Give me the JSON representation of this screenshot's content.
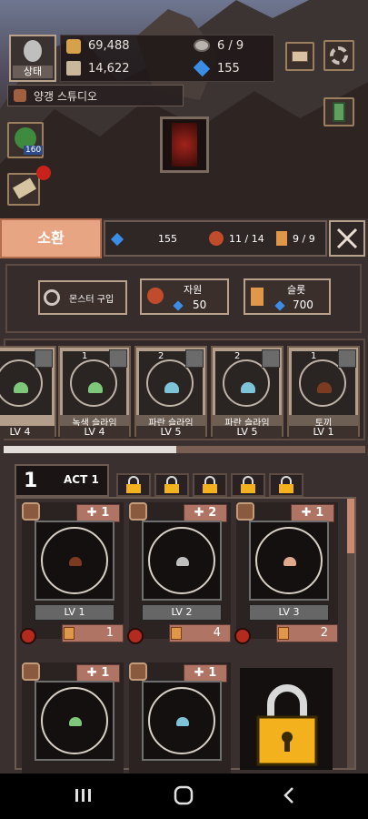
{
  "top": {
    "status_label": "상태",
    "gold": "69,488",
    "scroll": "14,622",
    "eye_count": "6 / 9",
    "gems": "155",
    "studio_name": "양갱 스튜디오",
    "clover_badge": "160"
  },
  "tabs": {
    "summon": "소환"
  },
  "resources": {
    "gems": "155",
    "meat": "11 / 14",
    "cards": "9 / 9"
  },
  "actions": {
    "buy_monster": "몬스터 구입",
    "resource_label": "자원",
    "resource_cost": "50",
    "slot_label": "슬롯",
    "slot_cost": "700"
  },
  "cards": [
    {
      "num": "",
      "name": "",
      "level": "LV 4"
    },
    {
      "num": "1",
      "name": "녹색 슬라임",
      "level": "LV 4"
    },
    {
      "num": "2",
      "name": "파란 슬라임",
      "level": "LV 5"
    },
    {
      "num": "2",
      "name": "파란 슬라임",
      "level": "LV 5"
    },
    {
      "num": "1",
      "name": "토끼",
      "level": "LV 1"
    }
  ],
  "act": {
    "number": "1",
    "label": "ACT 1"
  },
  "tiles": [
    {
      "plus": "1",
      "level": "LV 1",
      "count": "1"
    },
    {
      "plus": "2",
      "level": "LV 2",
      "count": "4"
    },
    {
      "plus": "1",
      "level": "LV 3",
      "count": "2"
    },
    {
      "plus": "1"
    },
    {
      "plus": "1"
    }
  ],
  "icons": [
    "person-icon",
    "gold-icon",
    "scroll-icon",
    "eye-icon",
    "gem-icon",
    "mail-icon",
    "gear-icon",
    "clover-icon",
    "map-icon",
    "book-icon",
    "close-icon",
    "trash-icon",
    "lock-icon",
    "plus-icon",
    "nav-recents-icon",
    "nav-home-icon",
    "nav-back-icon"
  ],
  "colors": {
    "accent": "#e8a583",
    "panel": "#3b3030",
    "gem": "#3a8ee6"
  }
}
